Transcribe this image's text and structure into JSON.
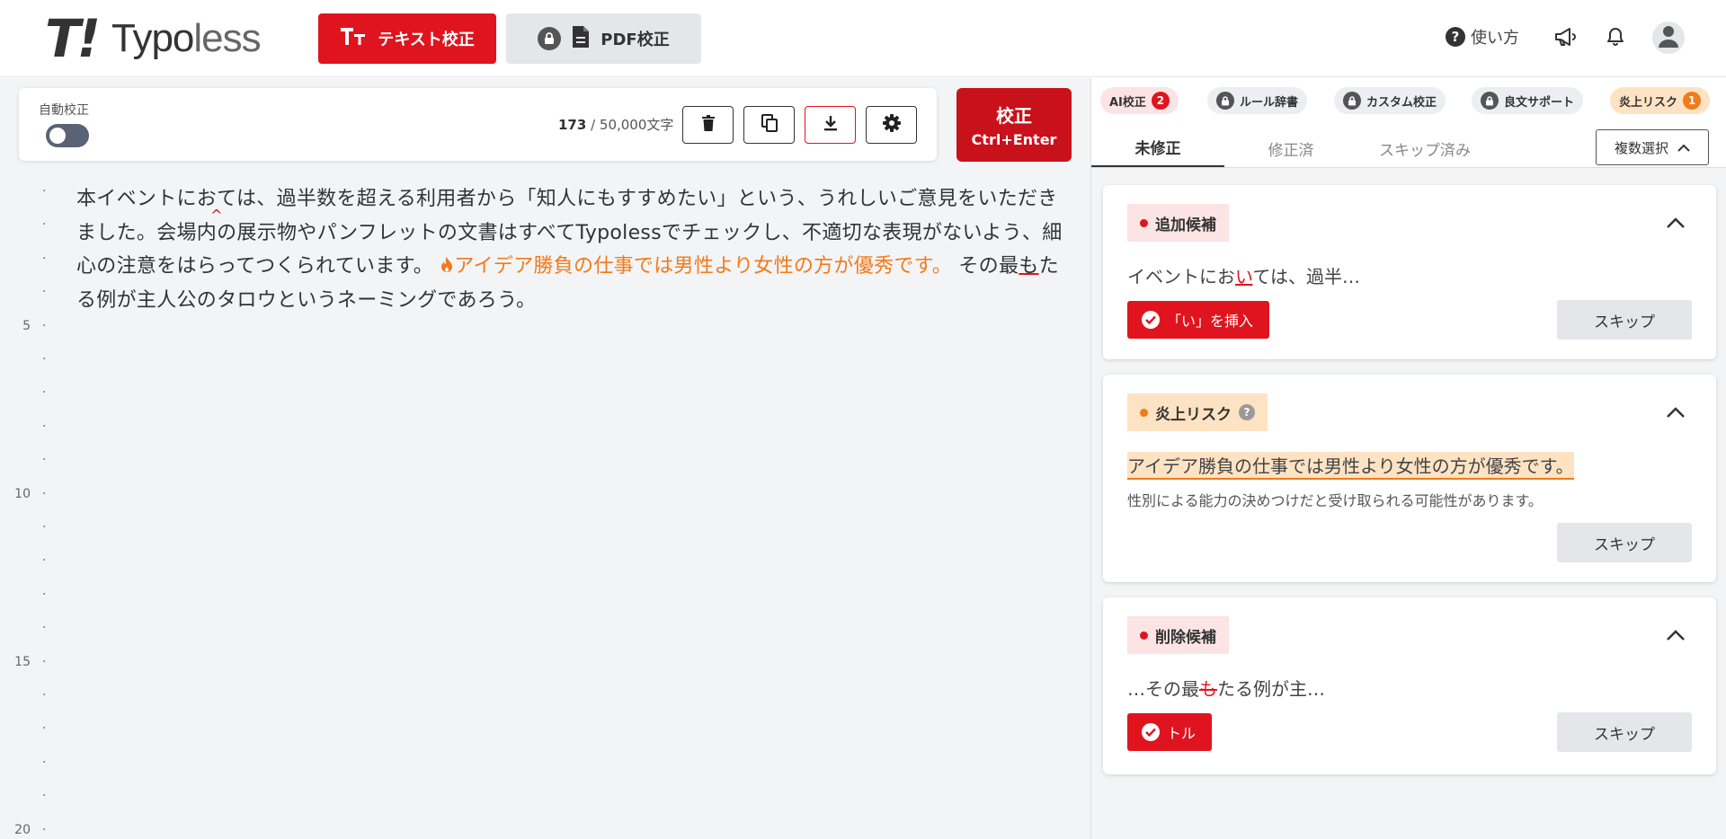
{
  "header": {
    "logo_mark": "T!",
    "logo_typo": "Typo",
    "logo_less": "less",
    "text_check_tt": "Tт",
    "text_check_label": "テキスト校正",
    "pdf_check_label": "PDF校正",
    "help_label": "使い方"
  },
  "toolbar": {
    "auto_label": "自動校正",
    "count_current": "173",
    "count_rest": " / 50,000文字",
    "check_label": "校正",
    "check_shortcut": "Ctrl+Enter"
  },
  "gutter": {
    "labels": [
      "",
      "",
      "",
      "",
      "5",
      "",
      "",
      "",
      "",
      "10",
      "",
      "",
      "",
      "",
      "15",
      "",
      "",
      "",
      "",
      "20"
    ]
  },
  "editor": {
    "seg1": "本イベントにお",
    "seg2": "ては、過半数を超える利用者から「知人にもすすめたい」という、うれしいご意見をいただきました。会場内の展示物やパンフレットの文書はすべてTypolessでチェックし、不適切な表現がないよう、細心の注意をはらってつくられています。",
    "flame_text": "アイデア勝負の仕事では男性より女性の方が優秀です。",
    "seg3": "その最",
    "seg_del": "も",
    "seg4": "たる例が主人公のタロウというネーミングであろう。"
  },
  "panel": {
    "tags": {
      "ai_label": "AI校正",
      "ai_count": "2",
      "rule_label": "ルール辞書",
      "custom_label": "カスタム校正",
      "good_label": "良文サポート",
      "risk_label": "炎上リスク",
      "risk_count": "1"
    },
    "tabs": {
      "unfixed": "未修正",
      "fixed": "修正済",
      "skipped": "スキップ済み"
    },
    "multi_select": "複数選択",
    "cards": [
      {
        "label": "追加候補",
        "snippet_pre": "イベントにお",
        "snippet_mark": "い",
        "snippet_post": "ては、過半…",
        "apply": "「い」を挿入",
        "skip": "スキップ"
      },
      {
        "label": "炎上リスク",
        "snippet": "アイデア勝負の仕事では男性より女性の方が優秀です。",
        "note": "性別による能力の決めつけだと受け取られる可能性があります。",
        "skip": "スキップ"
      },
      {
        "label": "削除候補",
        "snippet_pre": "…その最",
        "snippet_mark": "も",
        "snippet_post": "たる例が主…",
        "apply": "トル",
        "skip": "スキップ"
      }
    ]
  },
  "colors": {
    "brand_red": "#e0141e",
    "risk_orange": "#f07b1a"
  }
}
